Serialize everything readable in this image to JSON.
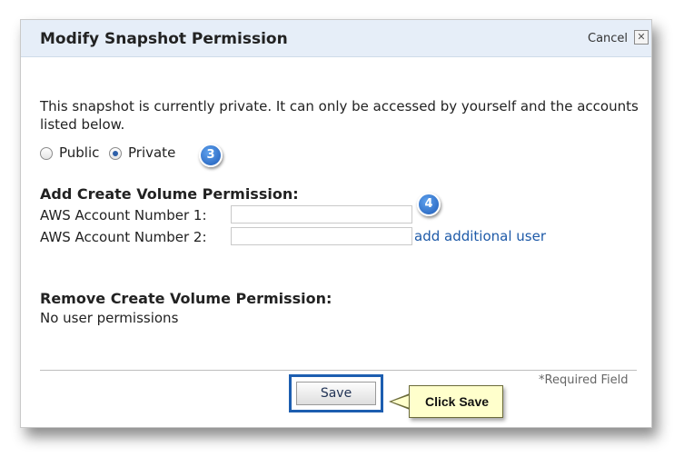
{
  "dialog": {
    "title": "Modify Snapshot Permission",
    "cancel_label": "Cancel",
    "close_glyph": "✕"
  },
  "description": "This snapshot is currently private. It can only be accessed by yourself and the accounts listed below.",
  "visibility": {
    "public_label": "Public",
    "private_label": "Private",
    "selected": "Private"
  },
  "annotations": {
    "step_3": "3",
    "step_4": "4",
    "callout": "Click Save"
  },
  "add_permission": {
    "heading": "Add Create Volume Permission:",
    "field1_label": "AWS Account Number 1:",
    "field1_value": "",
    "field2_label": "AWS Account Number 2:",
    "field2_value": "",
    "add_user_link": "add additional user"
  },
  "remove_permission": {
    "heading": "Remove Create Volume Permission:",
    "status": "No user permissions"
  },
  "footer": {
    "required_note": "*Required Field",
    "save_label": "Save"
  },
  "colors": {
    "accent": "#1d5eb0",
    "link": "#1e5aa8",
    "callout_bg": "#ffffcc"
  }
}
